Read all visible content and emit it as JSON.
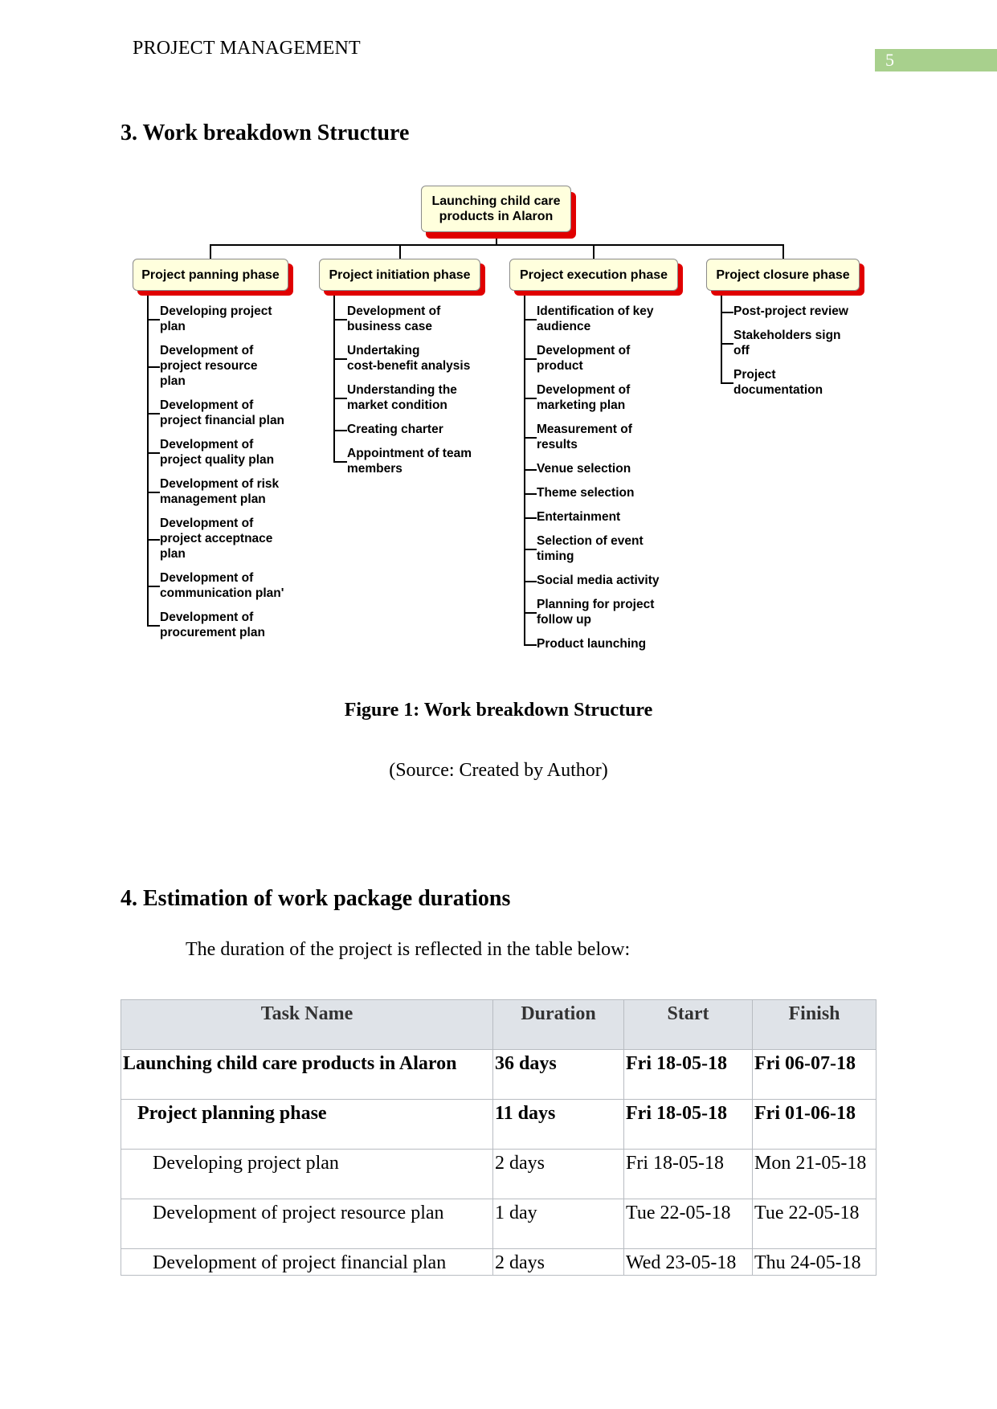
{
  "header": {
    "title": "PROJECT MANAGEMENT",
    "page_number": "5",
    "page_number_color": "#a8d08d"
  },
  "section3": {
    "heading": "3. Work breakdown Structure",
    "wbs": {
      "root": [
        "Launching child care",
        "products in Alaron"
      ],
      "colors": {
        "box_fill": "#ffffdd",
        "shadow": "#e00000"
      },
      "phases": [
        {
          "label": "Project panning phase",
          "items": [
            [
              "Developing project",
              "plan"
            ],
            [
              "Development of",
              "project resource",
              "plan"
            ],
            [
              "Development of",
              "project financial plan"
            ],
            [
              "Development of",
              "project quality plan"
            ],
            [
              "Development of risk",
              "management plan"
            ],
            [
              "Development of",
              "project acceptnace",
              "plan"
            ],
            [
              "Development of",
              "communication plan'"
            ],
            [
              "Development of",
              "procurement plan"
            ]
          ]
        },
        {
          "label": "Project initiation phase",
          "items": [
            [
              "Development of",
              "business case"
            ],
            [
              "Undertaking",
              "cost-benefit analysis"
            ],
            [
              "Understanding the",
              "market condition"
            ],
            [
              "Creating charter"
            ],
            [
              "Appointment of team",
              "members"
            ]
          ]
        },
        {
          "label": "Project execution phase",
          "items": [
            [
              "Identification of key",
              "audience"
            ],
            [
              "Development of",
              "product"
            ],
            [
              "Development of",
              "marketing plan"
            ],
            [
              "Measurement of",
              "results"
            ],
            [
              "Venue selection"
            ],
            [
              "Theme selection"
            ],
            [
              "Entertainment"
            ],
            [
              "Selection of event",
              "timing"
            ],
            [
              "Social media activity"
            ],
            [
              "Planning for project",
              "follow up"
            ],
            [
              "Product launching"
            ]
          ]
        },
        {
          "label": "Project closure phase",
          "items": [
            [
              "Post-project review"
            ],
            [
              "Stakeholders sign",
              "off"
            ],
            [
              "Project",
              "documentation"
            ]
          ]
        }
      ]
    },
    "figure_caption": "Figure 1: Work breakdown Structure",
    "figure_source": "(Source: Created by Author)"
  },
  "section4": {
    "heading": "4. Estimation of work package durations",
    "intro": "The duration of the project is reflected in the table below:",
    "table": {
      "columns": [
        "Task Name",
        "Duration",
        "Start",
        "Finish"
      ],
      "rows": [
        {
          "level": 0,
          "bold": true,
          "task": "Launching child care products in Alaron",
          "duration": "36 days",
          "start": "Fri 18-05-18",
          "finish": "Fri 06-07-18"
        },
        {
          "level": 1,
          "bold": true,
          "task": "Project planning phase",
          "duration": "11 days",
          "start": "Fri 18-05-18",
          "finish": "Fri 01-06-18"
        },
        {
          "level": 2,
          "bold": false,
          "task": "Developing project plan",
          "duration": "2 days",
          "start": "Fri 18-05-18",
          "finish": "Mon 21-05-18"
        },
        {
          "level": 2,
          "bold": false,
          "task": "Development of project resource plan",
          "duration": "1 day",
          "start": "Tue 22-05-18",
          "finish": "Tue 22-05-18"
        },
        {
          "level": 2,
          "bold": false,
          "task": "Development of project financial plan",
          "duration": "2 days",
          "start": "Wed 23-05-18",
          "finish": "Thu 24-05-18"
        }
      ]
    }
  }
}
